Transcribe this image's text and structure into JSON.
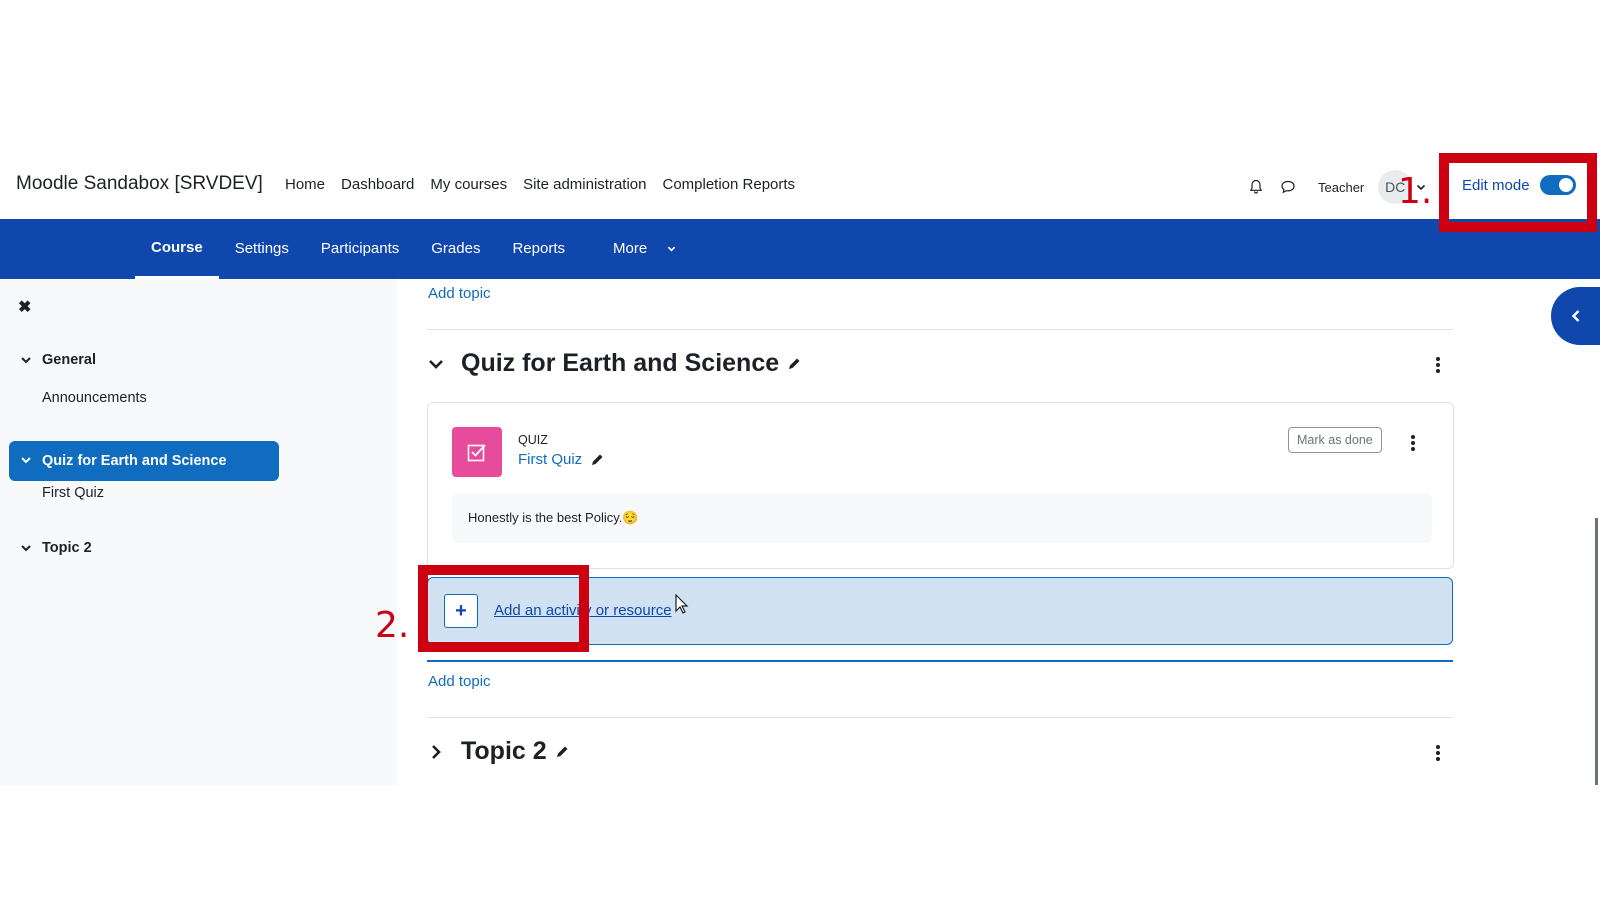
{
  "navbar": {
    "brand": "Moodle Sandabox [SRVDEV]",
    "links": [
      "Home",
      "Dashboard",
      "My courses",
      "Site administration",
      "Completion Reports"
    ],
    "role": "Teacher",
    "avatar_initials": "DC",
    "edit_mode_label": "Edit mode",
    "edit_mode_on": true
  },
  "course_nav": {
    "items": [
      "Course",
      "Settings",
      "Participants",
      "Grades",
      "Reports",
      "More"
    ],
    "active": "Course"
  },
  "drawer": {
    "sections": [
      {
        "label": "General",
        "items": [
          "Announcements"
        ]
      },
      {
        "label": "Quiz for Earth and Science",
        "items": [
          "First Quiz"
        ],
        "active": true
      },
      {
        "label": "Topic 2",
        "items": []
      }
    ]
  },
  "main": {
    "add_topic": "Add topic",
    "section1": {
      "title": "Quiz for Earth and Science",
      "activity": {
        "type": "QUIZ",
        "name": "First Quiz",
        "mark_done": "Mark as done",
        "description": "Honestly is the best Policy.😌"
      },
      "add_activity": "Add an activity or resource"
    },
    "section2": {
      "title": "Topic 2"
    }
  },
  "annotations": {
    "step1": "1.",
    "step2": "2."
  },
  "colors": {
    "brand_blue": "#0f47ad",
    "link_blue": "#0f6cbf",
    "quiz_pink": "#e74c9c",
    "annotation_red": "#cc0011"
  }
}
